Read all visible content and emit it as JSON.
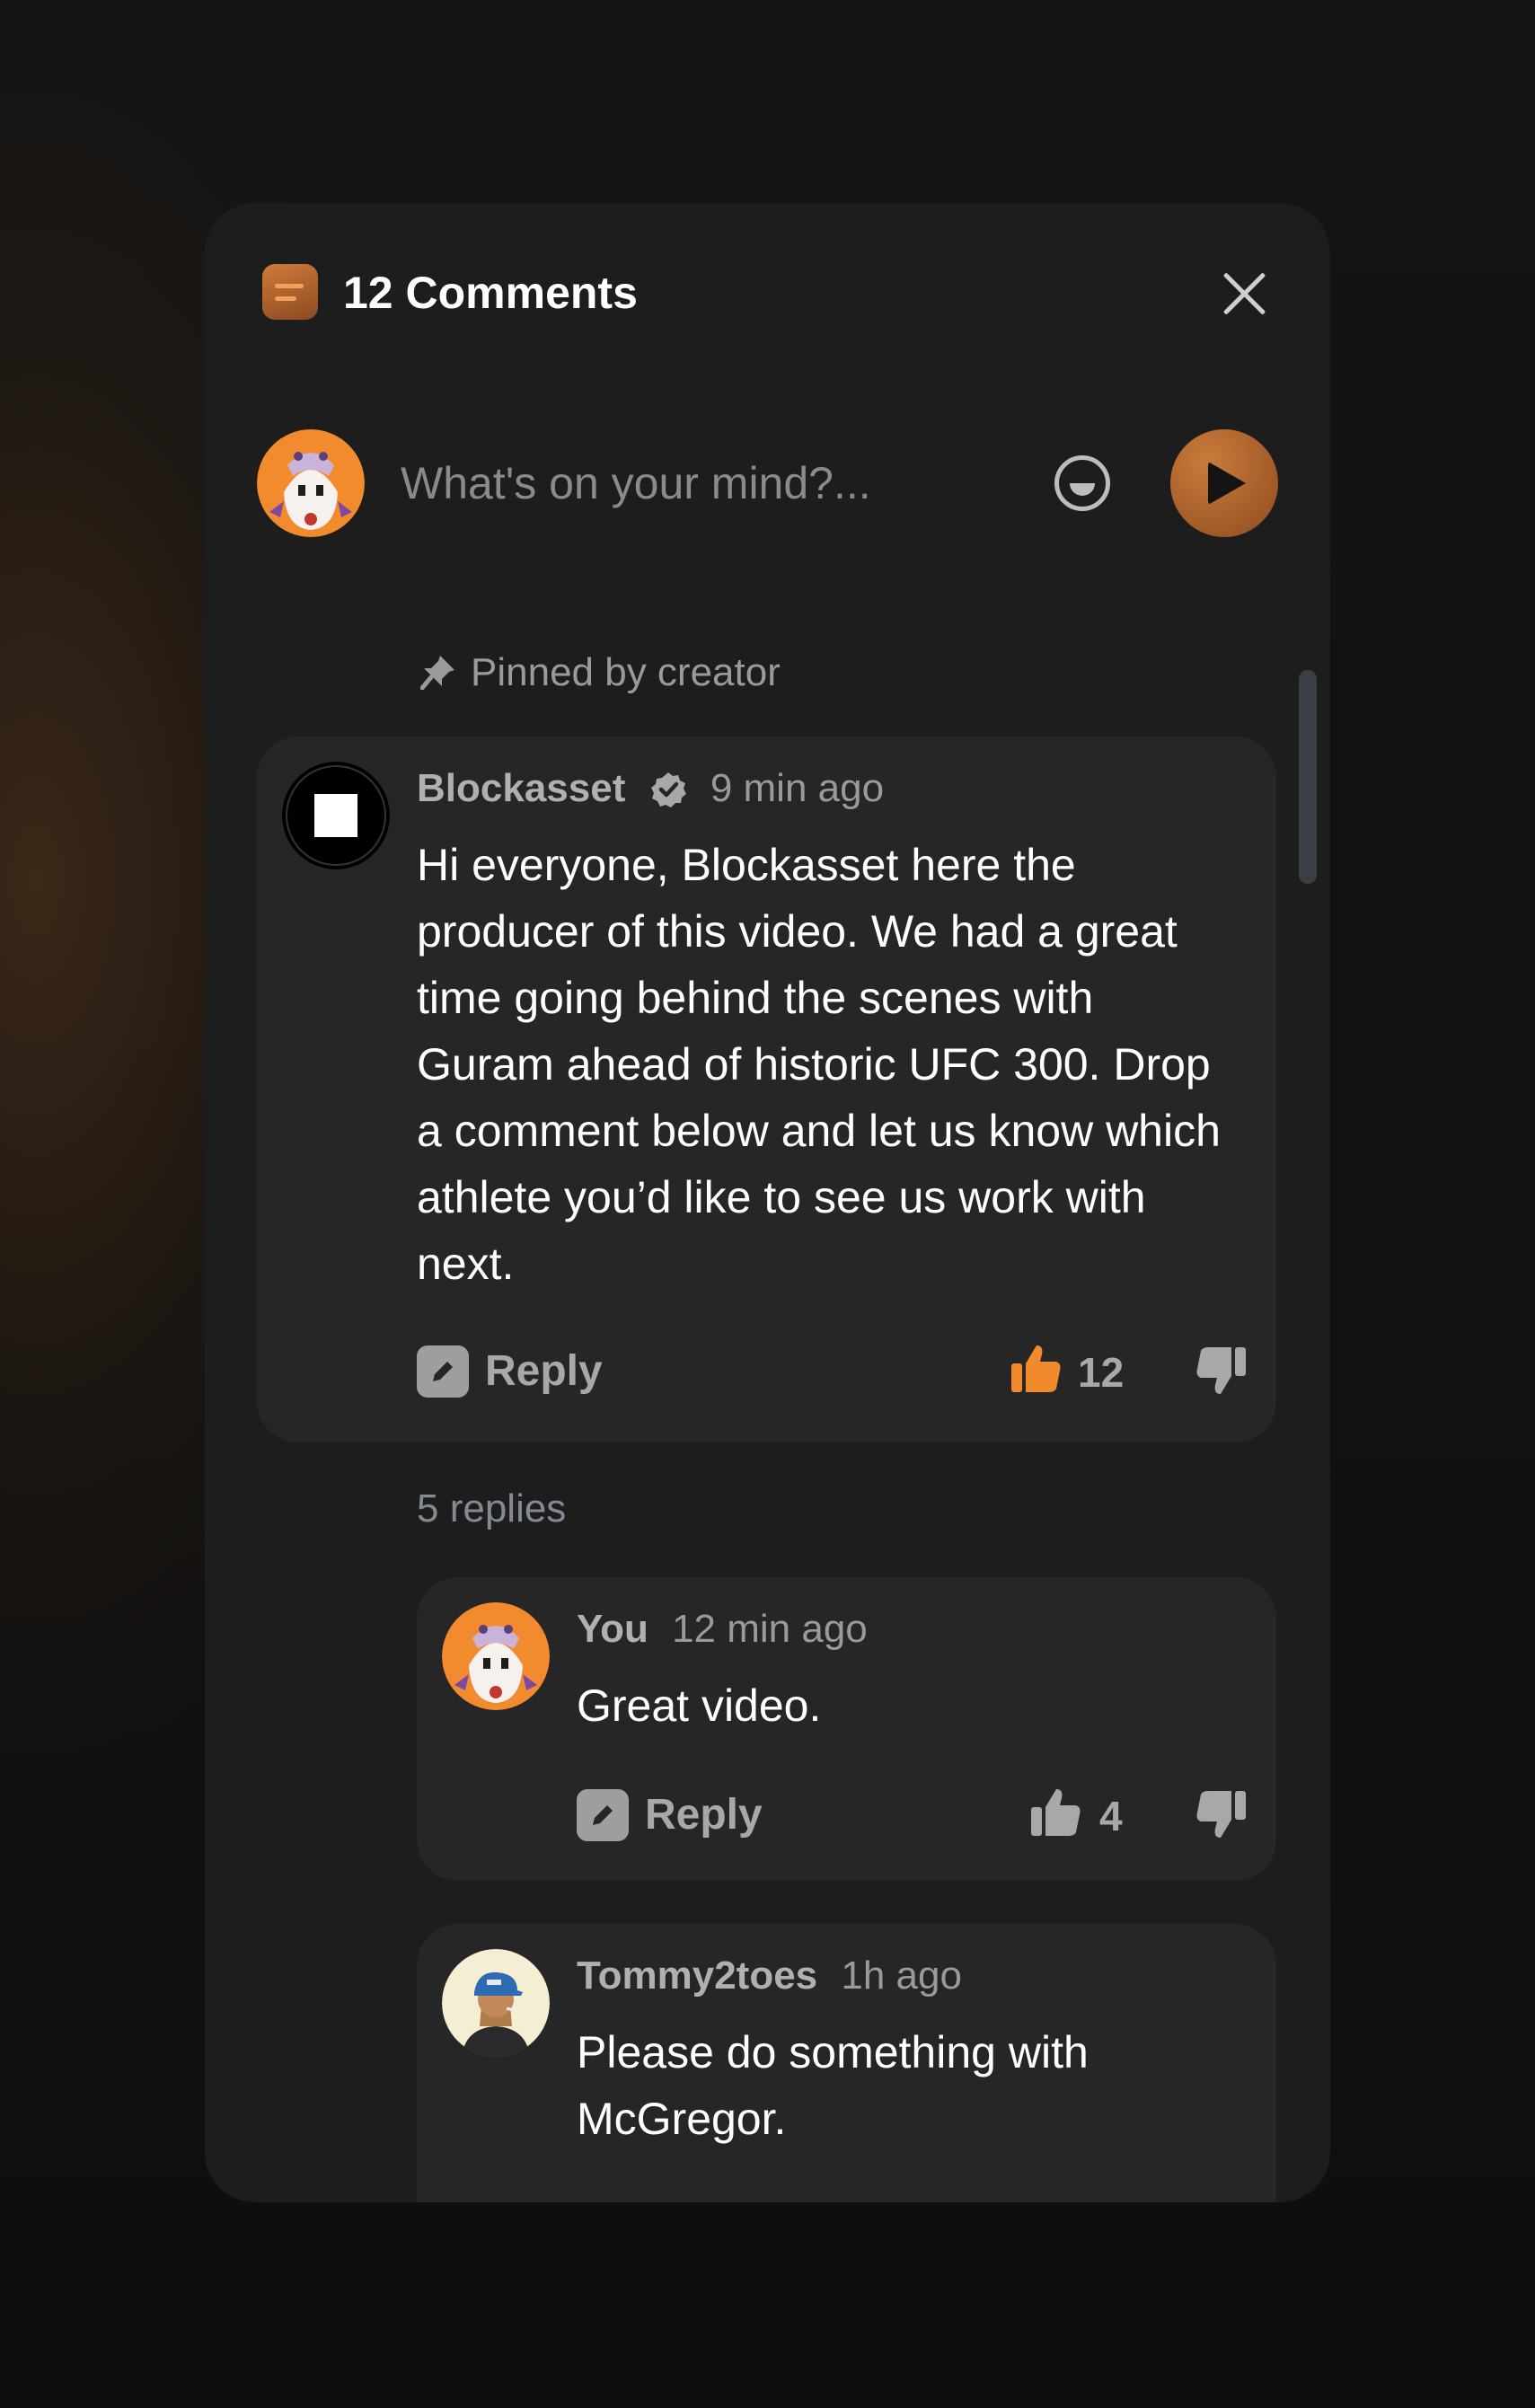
{
  "header": {
    "icon": "comments-icon",
    "title": "12 Comments",
    "close_icon": "close-icon"
  },
  "composer": {
    "placeholder": "What's on your mind?...",
    "emoji_icon": "emoji-icon",
    "send_icon": "send-icon"
  },
  "pinned": {
    "icon": "pin-icon",
    "label": "Pinned by creator"
  },
  "comment": {
    "author": "Blockasset",
    "verified_icon": "verified-badge-icon",
    "time": "9 min ago",
    "text": "Hi everyone, Blockasset here the producer of this video. We had a great time going behind the scenes with Guram ahead of historic UFC 300. Drop a comment below and let us know which athlete you’d like to see us work with next.",
    "reply_label": "Reply",
    "likes": "12",
    "like_active": true
  },
  "replies_label": "5 replies",
  "replies": [
    {
      "author": "You",
      "time": "12 min ago",
      "text": "Great video.",
      "reply_label": "Reply",
      "likes": "4"
    },
    {
      "author": "Tommy2toes",
      "time": "1h ago",
      "text": "Please do something with McGregor."
    }
  ],
  "colors": {
    "accent": "#f08a2c",
    "panel": "#1d1d1e",
    "card": "#262627"
  }
}
